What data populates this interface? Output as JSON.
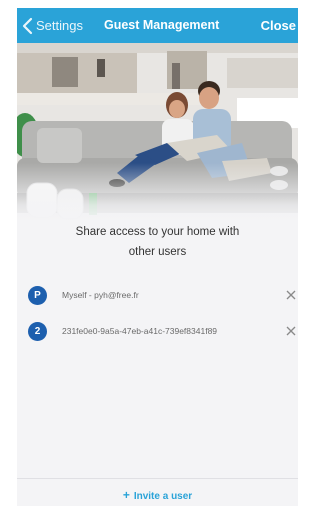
{
  "navbar": {
    "back_label": "Settings",
    "title": "Guest Management",
    "close_label": "Close",
    "color": "#2aa3d8"
  },
  "hero": {
    "icon": "family-on-sofa-photo"
  },
  "share_message": {
    "line1": "Share access to your home with",
    "line2": "other users"
  },
  "users": [
    {
      "avatar_letter": "P",
      "label": "Myself - pyh@free.fr",
      "remove_icon": "close-icon"
    },
    {
      "avatar_letter": "2",
      "label": "231fe0e0-9a5a-47eb-a41c-739ef8341f89",
      "remove_icon": "close-icon"
    }
  ],
  "footer": {
    "invite_plus": "+",
    "invite_label": "Invite a user",
    "accent": "#2aa3d8"
  },
  "avatar_color": "#1d5fae"
}
